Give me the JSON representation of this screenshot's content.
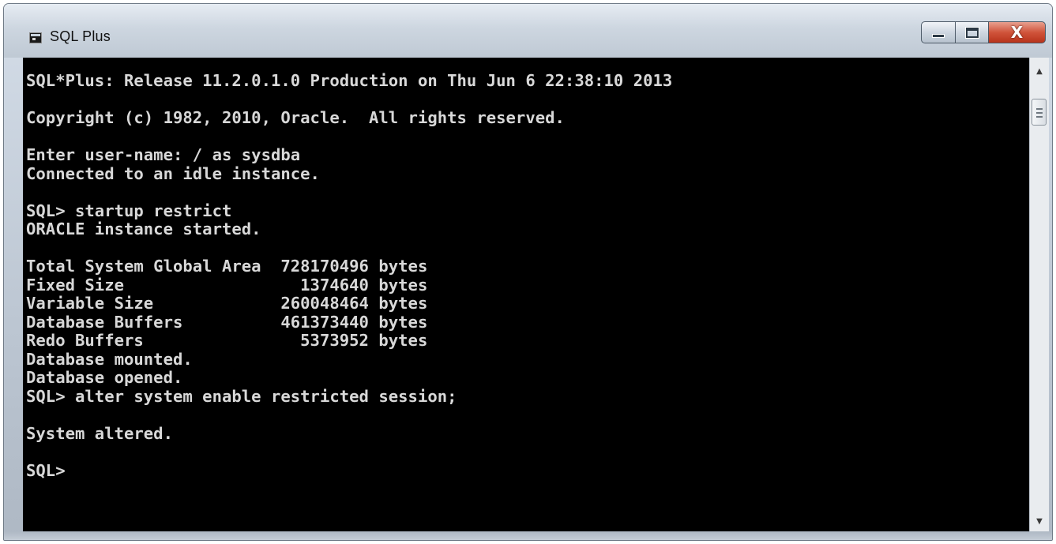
{
  "window": {
    "title": "SQL Plus",
    "icons": {
      "app": "console-app-icon",
      "minimize": "minimize-icon",
      "maximize": "maximize-icon",
      "close": "close-icon"
    },
    "close_glyph": "X"
  },
  "console": {
    "text": "SQL*Plus: Release 11.2.0.1.0 Production on Thu Jun 6 22:38:10 2013\n\nCopyright (c) 1982, 2010, Oracle.  All rights reserved.\n\nEnter user-name: / as sysdba\nConnected to an idle instance.\n\nSQL> startup restrict\nORACLE instance started.\n\nTotal System Global Area  728170496 bytes\nFixed Size                  1374640 bytes\nVariable Size             260048464 bytes\nDatabase Buffers          461373440 bytes\nRedo Buffers                5373952 bytes\nDatabase mounted.\nDatabase opened.\nSQL> alter system enable restricted session;\n\nSystem altered.\n\nSQL>",
    "background": "#000000",
    "foreground": "#d8d8d8"
  },
  "scrollbar": {
    "up_arrow": "▲",
    "down_arrow": "▼"
  }
}
